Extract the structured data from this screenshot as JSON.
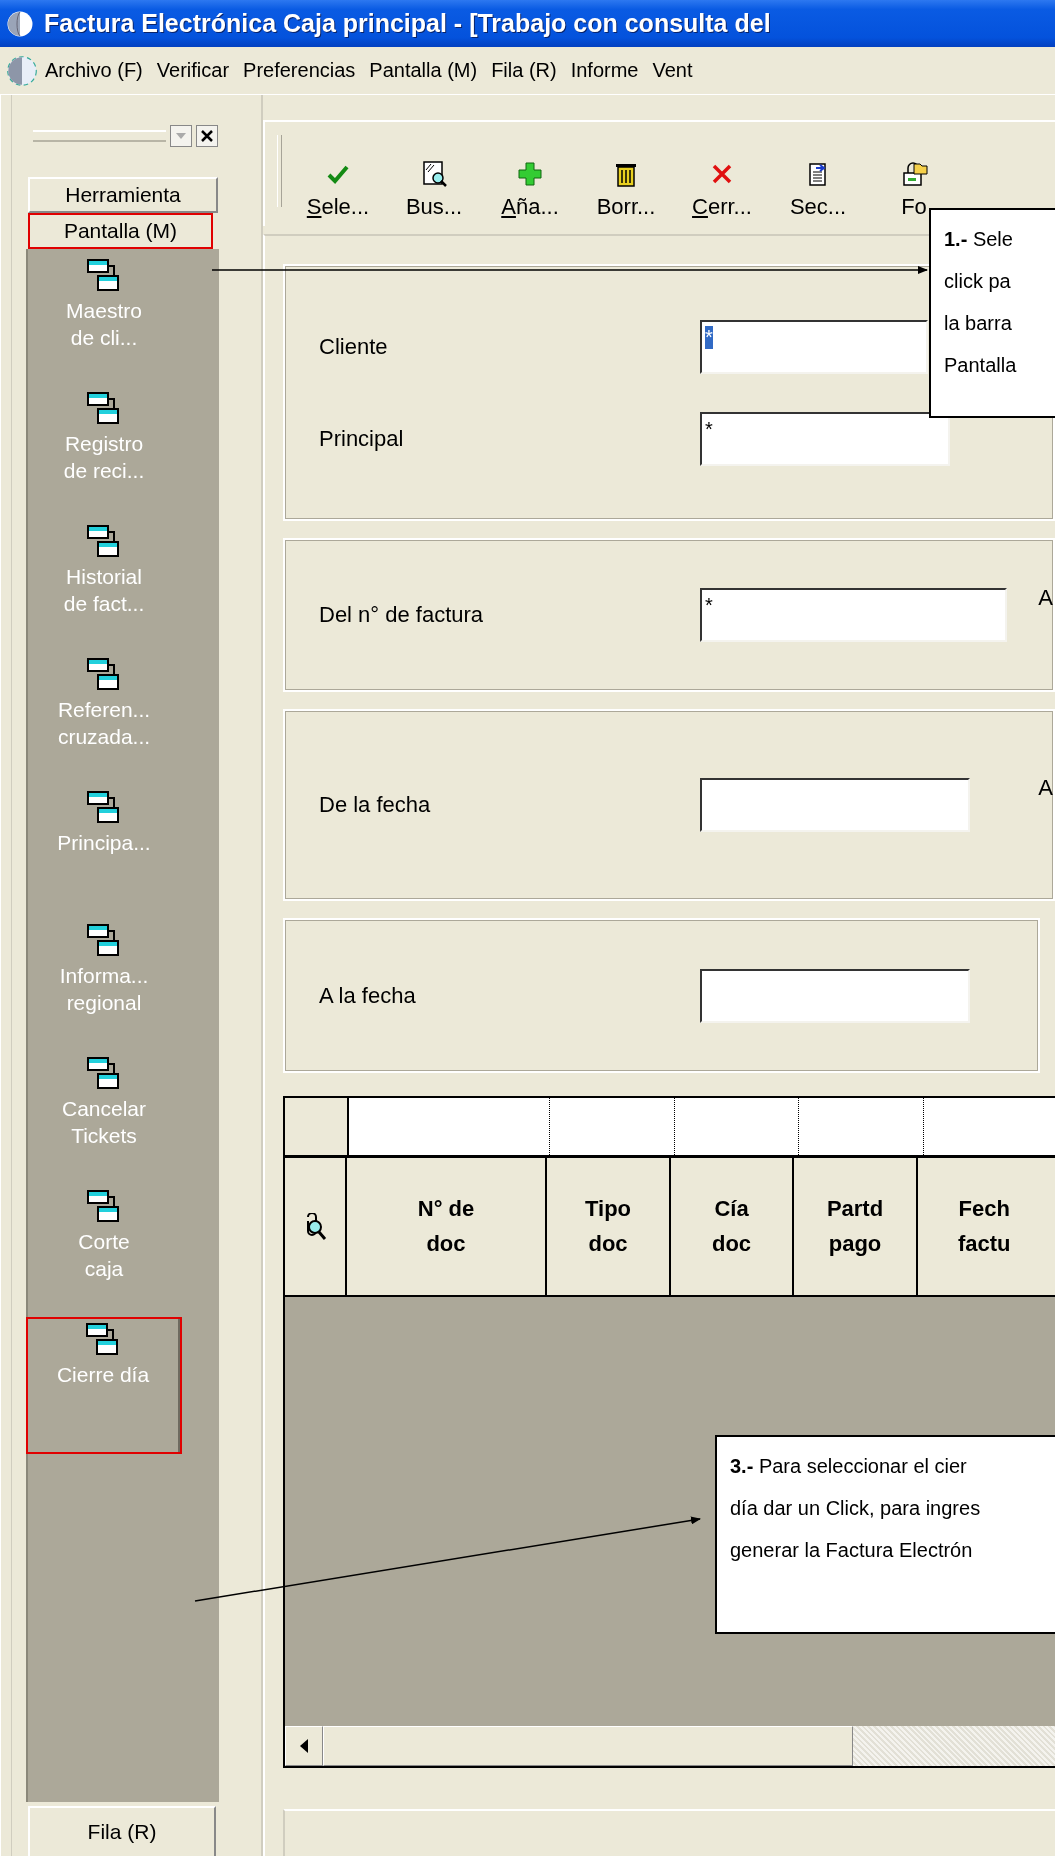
{
  "window": {
    "title": "Factura Electrónica Caja principal - [Trabajo con consulta del"
  },
  "menu_bar": {
    "items": [
      "Archivo (F)",
      "Verificar",
      "Preferencias",
      "Pantalla (M)",
      "Fila (R)",
      "Informe",
      "Vent"
    ]
  },
  "sidebar": {
    "tabs": [
      {
        "label": "Herramienta",
        "highlighted": false
      },
      {
        "label": "Pantalla (M)",
        "highlighted": true
      }
    ],
    "items": [
      {
        "lines": [
          "Maestro",
          "de cli..."
        ],
        "highlighted": false
      },
      {
        "lines": [
          "Registro",
          "de reci..."
        ],
        "highlighted": false
      },
      {
        "lines": [
          "Historial",
          "de fact..."
        ],
        "highlighted": false
      },
      {
        "lines": [
          "Referen...",
          "cruzada..."
        ],
        "highlighted": false
      },
      {
        "lines": [
          "Principa..."
        ],
        "highlighted": false
      },
      {
        "lines": [
          "Informa...",
          "regional"
        ],
        "highlighted": false
      },
      {
        "lines": [
          "Cancelar",
          "Tickets"
        ],
        "highlighted": false
      },
      {
        "lines": [
          "Corte",
          "caja"
        ],
        "highlighted": false
      },
      {
        "lines": [
          "Cierre día"
        ],
        "highlighted": true
      }
    ],
    "footer_tab": "Fila (R)"
  },
  "toolbar": {
    "buttons": [
      {
        "label": "Sele...",
        "mnemonic": true
      },
      {
        "label": "Bus...",
        "mnemonic": false
      },
      {
        "label": "Aña...",
        "mnemonic": true
      },
      {
        "label": "Borr...",
        "mnemonic": false
      },
      {
        "label": "Cerr...",
        "mnemonic": true
      },
      {
        "label": "Sec...",
        "mnemonic": false
      },
      {
        "label": "Fo",
        "mnemonic": false
      }
    ]
  },
  "form": {
    "sections": [
      {
        "fields": [
          {
            "label": "Cliente",
            "value": "*",
            "value_selected": true
          },
          {
            "label": "Principal",
            "value": "*",
            "value_selected": false
          }
        ]
      },
      {
        "fields": [
          {
            "label": "Del n° de factura",
            "value": "*",
            "value_selected": false
          }
        ],
        "trailing_label": "A"
      },
      {
        "fields": [
          {
            "label": "De la fecha"
          }
        ],
        "trailing_label": "A"
      },
      {
        "fields": [
          {
            "label": "A la fecha"
          }
        ]
      }
    ]
  },
  "grid": {
    "columns": [
      {
        "kind": "icon"
      },
      {
        "kind": "text",
        "label": "N° de\ndoc"
      },
      {
        "kind": "text",
        "label": "Tipo\ndoc"
      },
      {
        "kind": "text",
        "label": "Cía\ndoc"
      },
      {
        "kind": "text",
        "label": "Partd\npago"
      },
      {
        "kind": "text",
        "label": "Fech\nfactu"
      }
    ]
  },
  "callouts": [
    {
      "lines": [
        "**1.-** Sele",
        "click pa",
        "la barra",
        "Pantalla"
      ]
    },
    {
      "lines": [
        "**3.-**  Para seleccionar el cier",
        "día dar un Click, para ingres",
        "generar la Factura Electrón"
      ]
    }
  ]
}
